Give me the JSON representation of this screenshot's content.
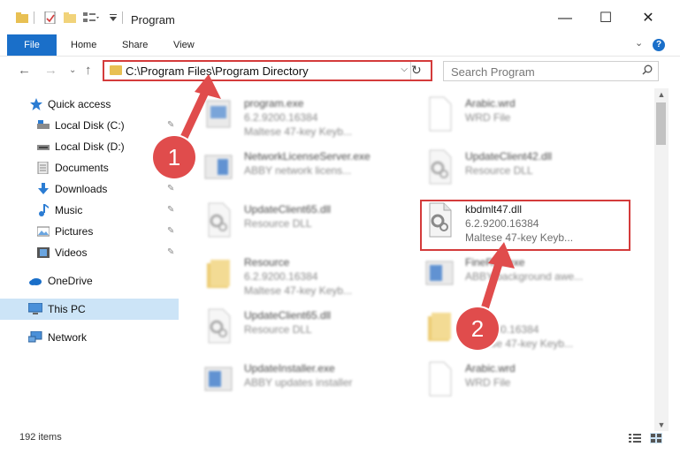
{
  "window": {
    "title": "Program",
    "minimize": "—",
    "maximize": "☐",
    "close": "✕"
  },
  "ribbon": {
    "tabs": [
      "File",
      "Home",
      "Share",
      "View"
    ],
    "expand": "⌄",
    "help": "?"
  },
  "address": {
    "path": "C:\\Program Files\\Program Directory",
    "dropdown": "⌵",
    "refresh": "↻"
  },
  "search": {
    "placeholder": "Search Program",
    "icon": "⚲"
  },
  "nav": {
    "back": "←",
    "forward": "→",
    "recent": "⌄",
    "up": "↑"
  },
  "sidebar": {
    "items": [
      {
        "label": "Quick access",
        "icon": "star-icon",
        "pinned": false
      },
      {
        "label": "Local Disk (C:)",
        "icon": "drive-icon",
        "pinned": true
      },
      {
        "label": "Local Disk (D:)",
        "icon": "drive-icon",
        "pinned": true
      },
      {
        "label": "Documents",
        "icon": "documents-icon",
        "pinned": true
      },
      {
        "label": "Downloads",
        "icon": "download-icon",
        "pinned": true
      },
      {
        "label": "Music",
        "icon": "music-icon",
        "pinned": true
      },
      {
        "label": "Pictures",
        "icon": "pictures-icon",
        "pinned": true
      },
      {
        "label": "Videos",
        "icon": "videos-icon",
        "pinned": true
      },
      {
        "label": "OneDrive",
        "icon": "cloud-icon",
        "pinned": false
      },
      {
        "label": "This PC",
        "icon": "computer-icon",
        "pinned": false,
        "selected": true
      },
      {
        "label": "Network",
        "icon": "network-icon",
        "pinned": false
      }
    ],
    "pin_glyph": "📌"
  },
  "files": [
    {
      "name": "program.exe",
      "line1": "6.2.9200.16384",
      "line2": "Maltese 47-key Keyb...",
      "icon": "exe-icon"
    },
    {
      "name": "Arabic.wrd",
      "line1": "WRD File",
      "line2": "",
      "icon": "document-icon"
    },
    {
      "name": "NetworkLicenseServer.exe",
      "line1": "ABBY network licens...",
      "line2": "",
      "icon": "exe-icon"
    },
    {
      "name": "UpdateClient42.dll",
      "line1": "Resource DLL",
      "line2": "",
      "icon": "dll-icon"
    },
    {
      "name": "UpdateClient65.dll",
      "line1": "Resource DLL",
      "line2": "",
      "icon": "dll-icon"
    },
    {
      "name": "kbdmlt47.dll",
      "line1": "6.2.9200.16384",
      "line2": "Maltese 47-key Keyb...",
      "icon": "dll-icon"
    },
    {
      "name": "Resource",
      "line1": "6.2.9200.16384",
      "line2": "Maltese 47-key Keyb...",
      "icon": "folder-icon"
    },
    {
      "name": "FineRec.exe",
      "line1": "ABBY background awe...",
      "line2": "",
      "icon": "exe-icon"
    },
    {
      "name": "UpdateClient65.dll",
      "line1": "Resource DLL",
      "line2": "",
      "icon": "dll-icon"
    },
    {
      "name": "",
      "line1": "6.2.9200.16384",
      "line2": "Maltese 47-key Keyb...",
      "icon": "folder-icon"
    },
    {
      "name": "UpdateInstaller.exe",
      "line1": "ABBY updates installer",
      "line2": "",
      "icon": "exe-icon"
    },
    {
      "name": "Arabic.wrd",
      "line1": "WRD File",
      "line2": "",
      "icon": "document-icon"
    }
  ],
  "status": {
    "items": "192 items"
  },
  "annotations": {
    "callout1": "1",
    "callout2": "2"
  },
  "colors": {
    "accent": "#1a6fc9",
    "highlight": "#d43b3b",
    "callout": "#e04c4c",
    "selected": "#cce4f7"
  }
}
